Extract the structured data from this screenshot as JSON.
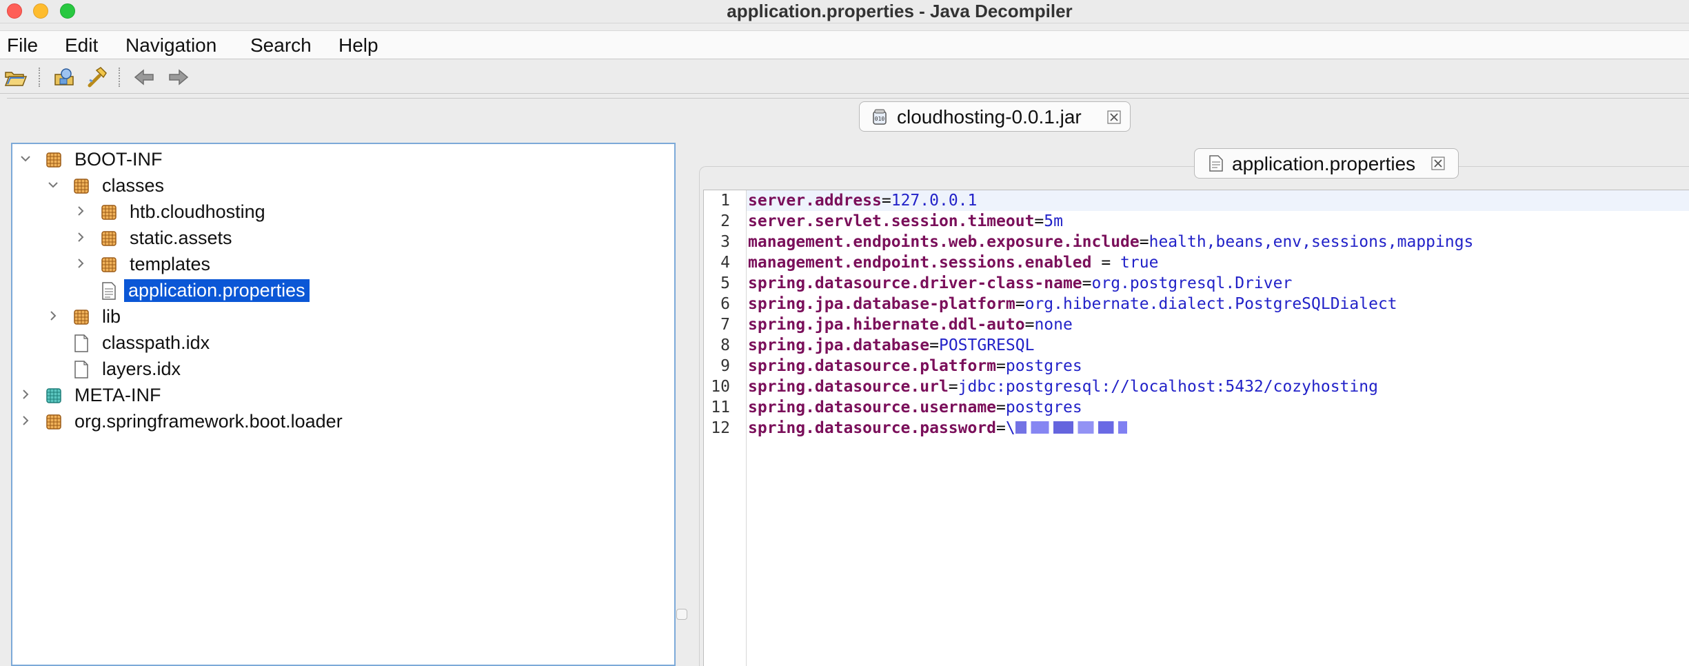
{
  "window": {
    "title": "application.properties - Java Decompiler"
  },
  "menu": {
    "items": [
      "File",
      "Edit",
      "Navigation",
      "Search",
      "Help"
    ]
  },
  "toolbar": {
    "buttons": [
      "open-file-icon",
      "open-type-icon",
      "search-icon",
      "back-arrow-icon",
      "forward-arrow-icon"
    ]
  },
  "jar_tab": {
    "label": "cloudhosting-0.0.1.jar"
  },
  "tree": {
    "nodes": [
      {
        "label": "BOOT-INF"
      },
      {
        "label": "classes"
      },
      {
        "label": "htb.cloudhosting"
      },
      {
        "label": "static.assets"
      },
      {
        "label": "templates"
      },
      {
        "label": "application.properties"
      },
      {
        "label": "lib"
      },
      {
        "label": "classpath.idx"
      },
      {
        "label": "layers.idx"
      },
      {
        "label": "META-INF"
      },
      {
        "label": "org.springframework.boot.loader"
      }
    ]
  },
  "editor": {
    "tab_label": "application.properties",
    "lines": [
      {
        "n": "1",
        "key": "server.address",
        "sep": "=",
        "value": "127.0.0.1"
      },
      {
        "n": "2",
        "key": "server.servlet.session.timeout",
        "sep": "=",
        "value": "5m"
      },
      {
        "n": "3",
        "key": "management.endpoints.web.exposure.include",
        "sep": "=",
        "value": "health,beans,env,sessions,mappings"
      },
      {
        "n": "4",
        "key": "management.endpoint.sessions.enabled",
        "sep": " = ",
        "value": "true"
      },
      {
        "n": "5",
        "key": "spring.datasource.driver-class-name",
        "sep": "=",
        "value": "org.postgresql.Driver"
      },
      {
        "n": "6",
        "key": "spring.jpa.database-platform",
        "sep": "=",
        "value": "org.hibernate.dialect.PostgreSQLDialect"
      },
      {
        "n": "7",
        "key": "spring.jpa.hibernate.ddl-auto",
        "sep": "=",
        "value": "none"
      },
      {
        "n": "8",
        "key": "spring.jpa.database",
        "sep": "=",
        "value": "POSTGRESQL"
      },
      {
        "n": "9",
        "key": "spring.datasource.platform",
        "sep": "=",
        "value": "postgres"
      },
      {
        "n": "10",
        "key": "spring.datasource.url",
        "sep": "=",
        "value": "jdbc:postgresql://localhost:5432/cozyhosting"
      },
      {
        "n": "11",
        "key": "spring.datasource.username",
        "sep": "=",
        "value": "postgres"
      },
      {
        "n": "12",
        "key": "spring.datasource.password",
        "sep": "=",
        "value": "\\"
      }
    ]
  },
  "colors": {
    "selection": "#0b57d6",
    "key": "#7a0f5a",
    "value": "#2222c8",
    "tree_border": "#7ca9d8"
  }
}
